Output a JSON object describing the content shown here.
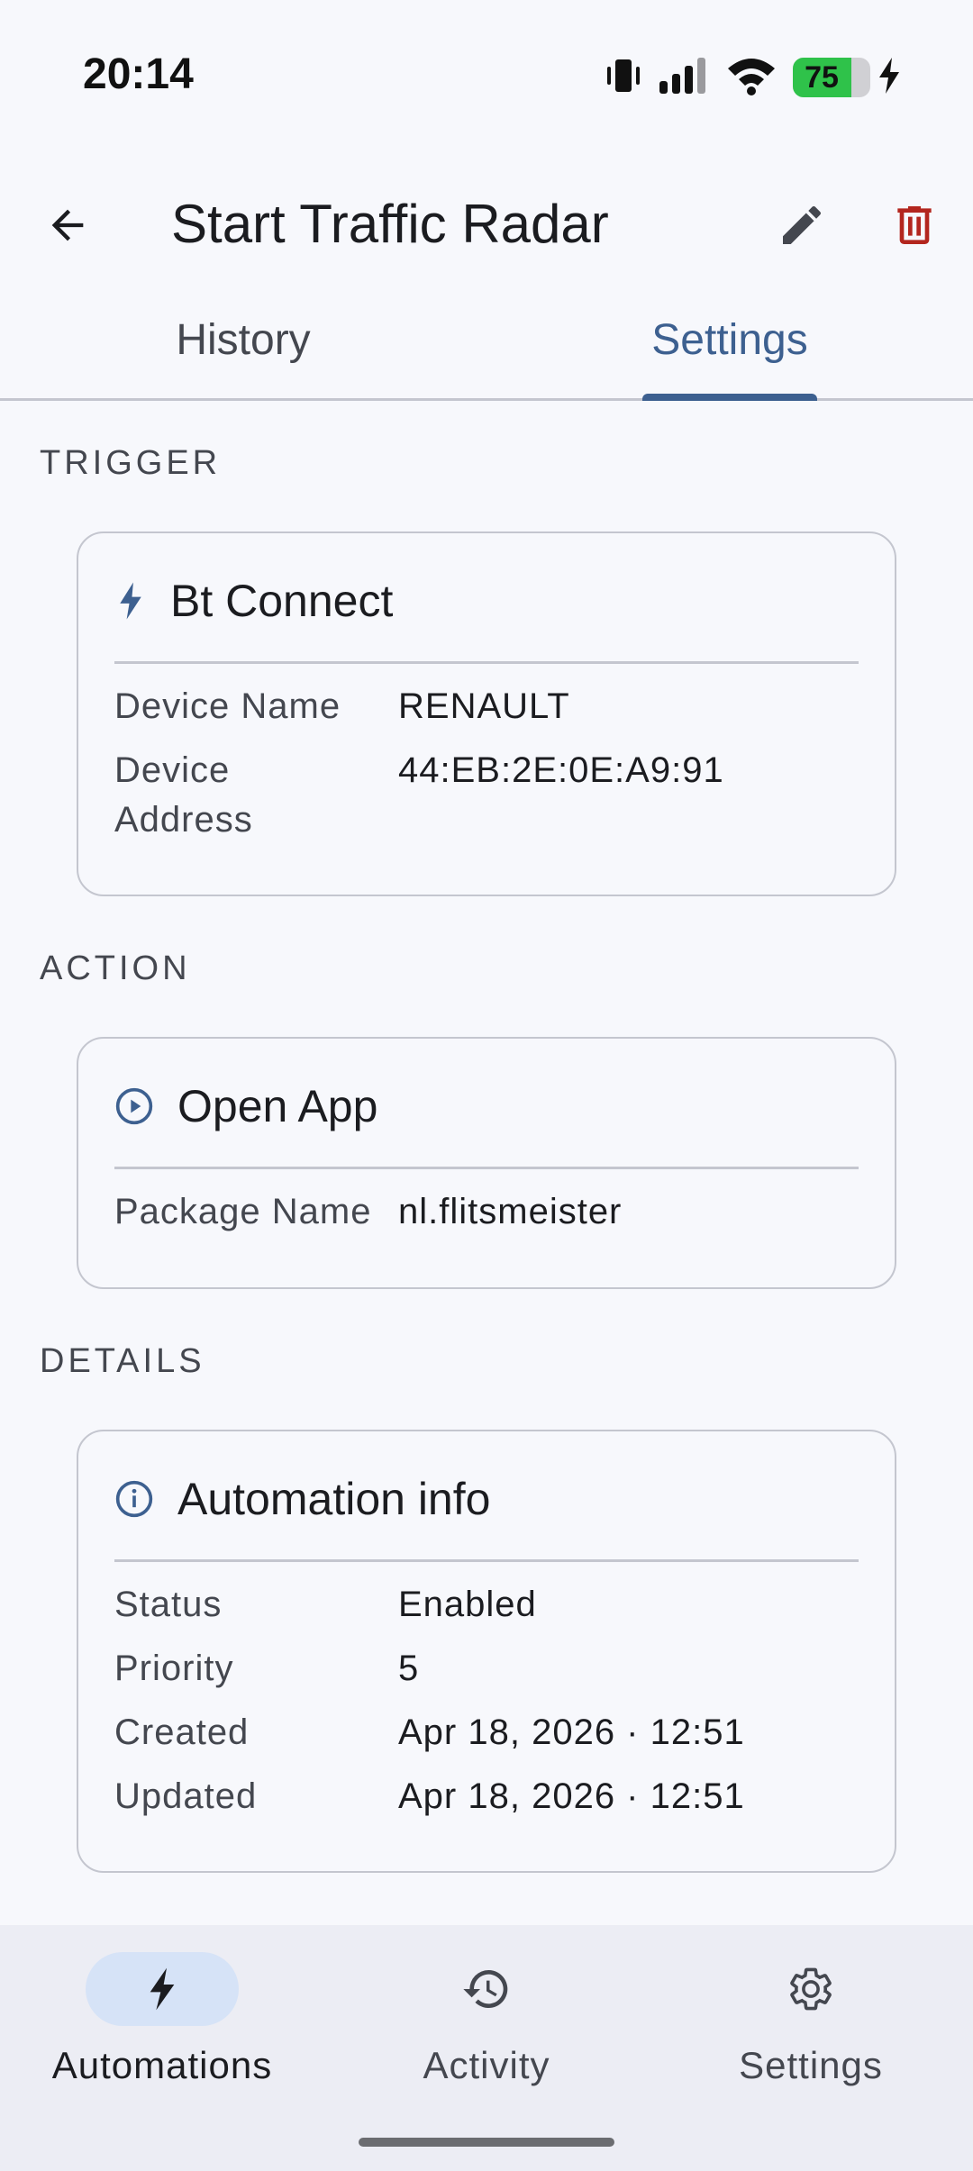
{
  "status_bar": {
    "time": "20:14",
    "battery_level": 75,
    "battery_text": "75",
    "icons": [
      "vibrate-icon",
      "signal-icon",
      "wifi-icon",
      "battery-icon",
      "charging-icon"
    ]
  },
  "app_bar": {
    "title": "Start Traffic Radar",
    "icons": [
      "arrow-back-icon",
      "edit-pencil-icon",
      "trash-icon"
    ]
  },
  "tabs": [
    {
      "label": "History",
      "selected": false
    },
    {
      "label": "Settings",
      "selected": true
    }
  ],
  "trigger": {
    "section_label": "TRIGGER",
    "icon": "bolt-icon",
    "title": "Bt Connect",
    "rows": [
      {
        "key": "Device Name",
        "value": "RENAULT"
      },
      {
        "key_line1": "Device",
        "key_line2": "Address",
        "value": "44:EB:2E:0E:A9:91"
      }
    ]
  },
  "action": {
    "section_label": "ACTION",
    "icon": "play-circle-icon",
    "title": "Open App",
    "rows": [
      {
        "key": "Package Name",
        "value": "nl.flitsmeister"
      }
    ]
  },
  "details": {
    "section_label": "DETAILS",
    "icon": "info-circle-icon",
    "title": "Automation info",
    "rows": [
      {
        "key": "Status",
        "value": "Enabled"
      },
      {
        "key": "Priority",
        "value": "5"
      },
      {
        "key": "Created",
        "value": "Apr 18, 2026 · 12:51"
      },
      {
        "key": "Updated",
        "value": "Apr 18, 2026 · 12:51"
      }
    ]
  },
  "bottom_nav": [
    {
      "label": "Automations",
      "icon": "bolt-icon",
      "active": true
    },
    {
      "label": "Activity",
      "icon": "history-icon",
      "active": false
    },
    {
      "label": "Settings",
      "icon": "gear-icon",
      "active": false
    }
  ],
  "colors": {
    "accent": "#3d6090",
    "delete": "#b3261e",
    "battery": "#2fc24a",
    "nav_active_pill": "#d6e3f7"
  }
}
